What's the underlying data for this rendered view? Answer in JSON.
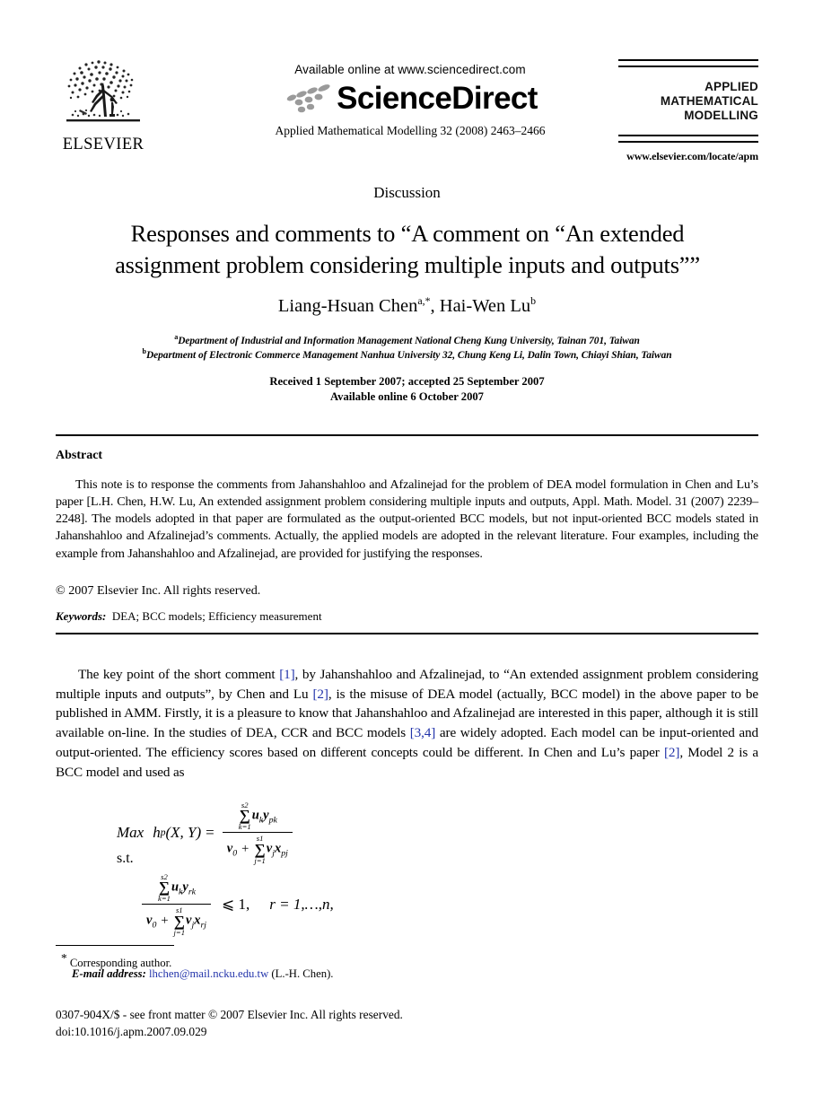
{
  "publisher": {
    "logo_name": "elsevier-tree-logo",
    "wordmark": "ELSEVIER"
  },
  "sciencedirect": {
    "available_line": "Available online at www.sciencedirect.com",
    "wordmark": "ScienceDirect",
    "journal_reference": "Applied Mathematical Modelling 32 (2008) 2463–2466"
  },
  "journal": {
    "name_line1": "APPLIED",
    "name_line2": "MATHEMATICAL",
    "name_line3": "MODELLING",
    "url": "www.elsevier.com/locate/apm"
  },
  "article": {
    "section_kind": "Discussion",
    "title_line1": "Responses and comments to “A comment on “An extended",
    "title_line2": "assignment problem considering multiple inputs and outputs””",
    "authors": {
      "author1_name": "Liang-Hsuan Chen",
      "author1_marks": "a,*",
      "separator": ", ",
      "author2_name": "Hai-Wen Lu",
      "author2_marks": "b"
    },
    "affiliations": [
      {
        "mark": "a",
        "text": "Department of Industrial and Information Management National Cheng Kung University, Tainan 701, Taiwan"
      },
      {
        "mark": "b",
        "text": "Department of Electronic Commerce Management Nanhua University 32, Chung Keng Li, Dalin Town, Chiayi Shian, Taiwan"
      }
    ],
    "history_line1": "Received 1 September 2007; accepted 25 September 2007",
    "history_line2": "Available online 6 October 2007"
  },
  "abstract": {
    "heading": "Abstract",
    "text": "This note is to response the comments from Jahanshahloo and Afzalinejad for the problem of DEA model formulation in Chen and Lu’s paper [L.H. Chen, H.W. Lu, An extended assignment problem considering multiple inputs and outputs, Appl. Math. Model. 31 (2007) 2239–2248]. The models adopted in that paper are formulated as the output-oriented BCC models, but not input-oriented BCC models stated in Jahanshahloo and Afzalinejad’s comments. Actually, the applied models are adopted in the relevant literature. Four examples, including the example from Jahanshahloo and Afzalinejad, are provided for justifying the responses.",
    "copyright": "© 2007 Elsevier Inc. All rights reserved.",
    "keywords_label": "Keywords:",
    "keywords_value": "DEA; BCC models; Efficiency measurement"
  },
  "body": {
    "para1_seg1": "The key point of the short comment ",
    "cite1": "[1]",
    "para1_seg2": ", by Jahanshahloo and Afzalinejad, to “An extended assignment problem considering multiple inputs and outputs”, by Chen and Lu ",
    "cite2": "[2]",
    "para1_seg3": ", is the misuse of DEA model (actually, BCC model) in the above paper to be published in AMM. Firstly, it is a pleasure to know that Jahanshahloo and Afzalinejad are interested in this paper, although it is still available on-line. In the studies of DEA, CCR and BCC models ",
    "cite3": "[3,4]",
    "para1_seg4": " are widely adopted. Each model can be input-oriented and output-oriented. The efficiency scores based on different concepts could be different. In Chen and Lu’s paper ",
    "cite4": "[2]",
    "para1_seg5": ", Model 2 is a BCC model and used as"
  },
  "equations": {
    "objective_label": "Max",
    "objective_function": "h",
    "objective_subscript": "p",
    "objective_args": "(X, Y)",
    "equals": "=",
    "num_sum_upper": "s2",
    "num_sum_lower": "k=1",
    "num_term": "u",
    "num_term_sub": "k",
    "num_term2": "y",
    "num_term2_sub": "pk",
    "den_first": "v",
    "den_first_sub": "0",
    "den_plus": "+",
    "den_sum_upper": "s1",
    "den_sum_lower": "j=1",
    "den_term": "v",
    "den_term_sub": "j",
    "den_term2": "x",
    "den_term2_sub": "pj",
    "subject_to": "s.t.",
    "c_num_sum_upper": "s2",
    "c_num_sum_lower": "k=1",
    "c_num_term": "u",
    "c_num_term_sub": "k",
    "c_num_term2": "y",
    "c_num_term2_sub": "rk",
    "c_den_first": "v",
    "c_den_first_sub": "0",
    "c_den_plus": "+",
    "c_den_sum_upper": "s1",
    "c_den_sum_lower": "j=1",
    "c_den_term": "v",
    "c_den_term_sub": "j",
    "c_den_term2": "x",
    "c_den_term2_sub": "rj",
    "c_relation": "⩽ 1,",
    "c_index": "r = 1,…,n,"
  },
  "footnotes": {
    "corresponding_mark": "*",
    "corresponding_text": "Corresponding author.",
    "email_label": "E-mail address:",
    "email_value": "lhchen@mail.ncku.edu.tw",
    "email_owner": "(L.-H. Chen)."
  },
  "imprint": {
    "issn_line": "0307-904X/$ - see front matter © 2007 Elsevier Inc. All rights reserved.",
    "doi_line": "doi:10.1016/j.apm.2007.09.029"
  },
  "colors": {
    "link": "#2233aa",
    "text": "#000000",
    "swoosh": "#9a9a9a"
  }
}
